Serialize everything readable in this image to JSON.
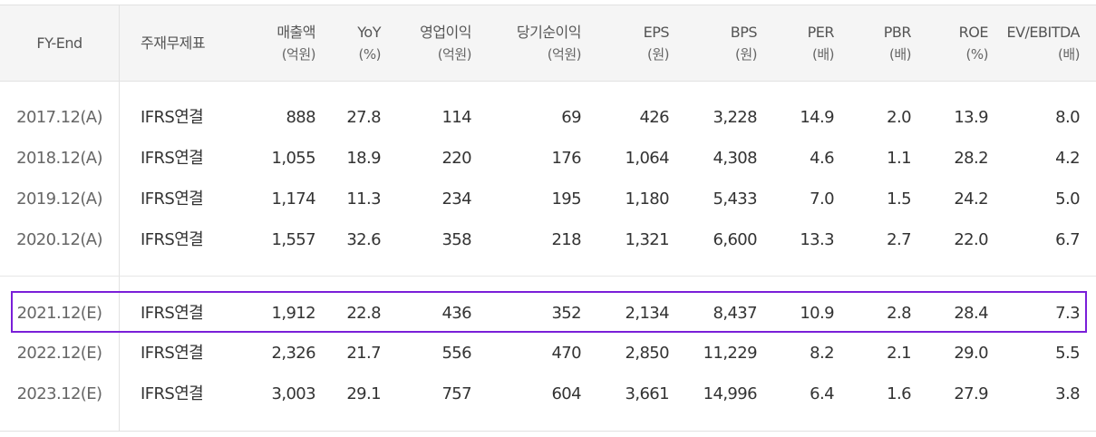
{
  "header": {
    "fy_end": "FY-End",
    "basis": "주재무제표",
    "columns": [
      {
        "label": "매출액",
        "unit": "(억원)"
      },
      {
        "label": "YoY",
        "unit": "(%)"
      },
      {
        "label": "영업이익",
        "unit": "(억원)"
      },
      {
        "label": "당기순이익",
        "unit": "(억원)"
      },
      {
        "label": "EPS",
        "unit": "(원)"
      },
      {
        "label": "BPS",
        "unit": "(원)"
      },
      {
        "label": "PER",
        "unit": "(배)"
      },
      {
        "label": "PBR",
        "unit": "(배)"
      },
      {
        "label": "ROE",
        "unit": "(%)"
      },
      {
        "label": "EV/EBITDA",
        "unit": "(배)"
      }
    ]
  },
  "highlight": {
    "color": "#7a1fd8",
    "row_fy": "2021.12(E)"
  },
  "rows": [
    {
      "fy": "2017.12(A)",
      "basis": "IFRS연결",
      "values": [
        "888",
        "27.8",
        "114",
        "69",
        "426",
        "3,228",
        "14.9",
        "2.0",
        "13.9",
        "8.0"
      ]
    },
    {
      "fy": "2018.12(A)",
      "basis": "IFRS연결",
      "values": [
        "1,055",
        "18.9",
        "220",
        "176",
        "1,064",
        "4,308",
        "4.6",
        "1.1",
        "28.2",
        "4.2"
      ]
    },
    {
      "fy": "2019.12(A)",
      "basis": "IFRS연결",
      "values": [
        "1,174",
        "11.3",
        "234",
        "195",
        "1,180",
        "5,433",
        "7.0",
        "1.5",
        "24.2",
        "5.0"
      ]
    },
    {
      "fy": "2020.12(A)",
      "basis": "IFRS연결",
      "values": [
        "1,557",
        "32.6",
        "358",
        "218",
        "1,321",
        "6,600",
        "13.3",
        "2.7",
        "22.0",
        "6.7"
      ]
    },
    {
      "fy": "2021.12(E)",
      "basis": "IFRS연결",
      "values": [
        "1,912",
        "22.8",
        "436",
        "352",
        "2,134",
        "8,437",
        "10.9",
        "2.8",
        "28.4",
        "7.3"
      ]
    },
    {
      "fy": "2022.12(E)",
      "basis": "IFRS연결",
      "values": [
        "2,326",
        "21.7",
        "556",
        "470",
        "2,850",
        "11,229",
        "8.2",
        "2.1",
        "29.0",
        "5.5"
      ]
    },
    {
      "fy": "2023.12(E)",
      "basis": "IFRS연결",
      "values": [
        "3,003",
        "29.1",
        "757",
        "604",
        "3,661",
        "14,996",
        "6.4",
        "1.6",
        "27.9",
        "3.8"
      ]
    }
  ]
}
